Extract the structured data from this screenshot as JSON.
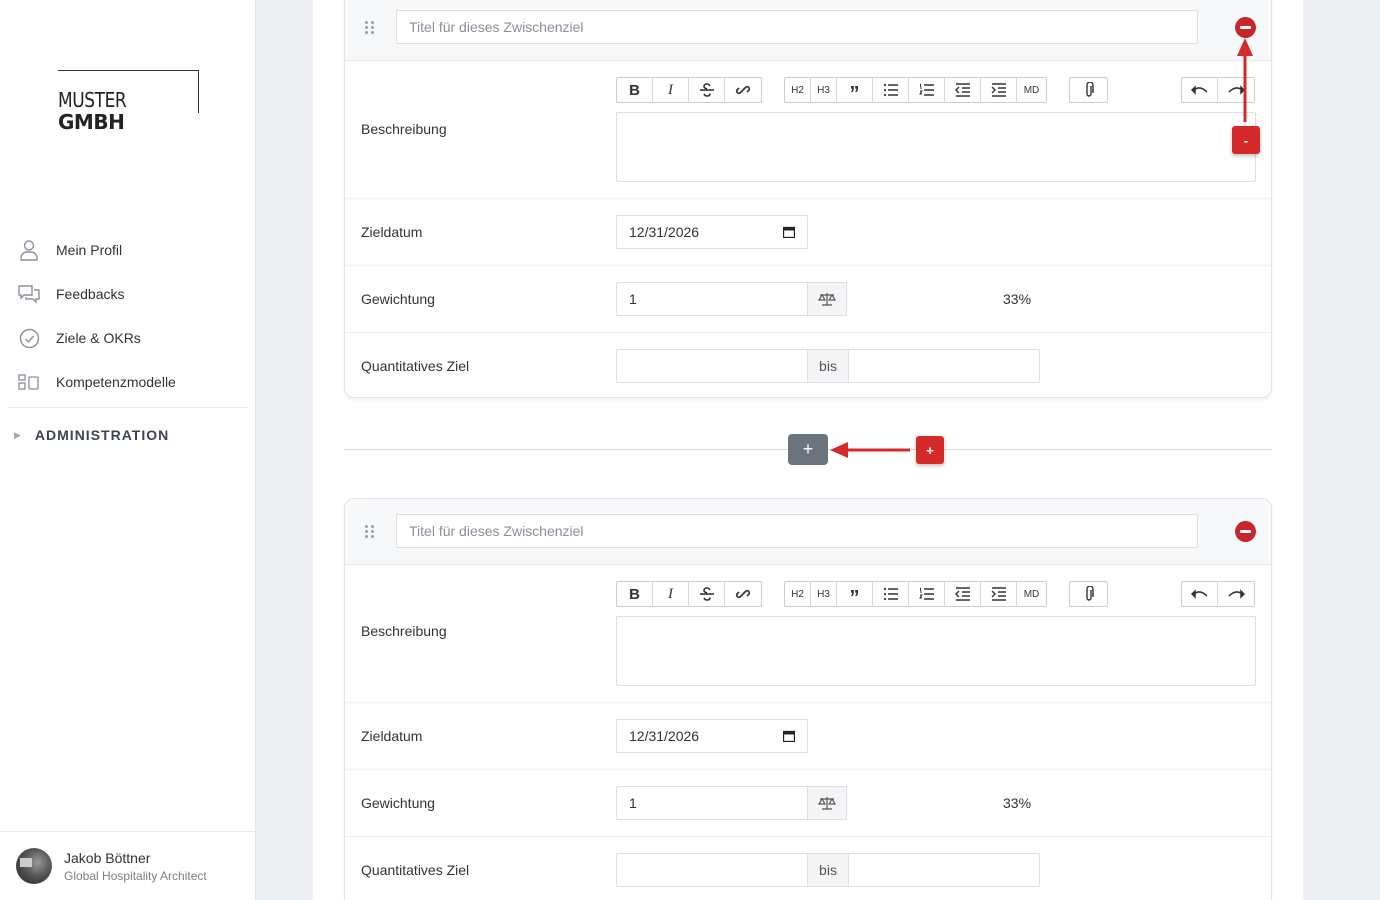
{
  "sidebar": {
    "logo": {
      "light": "MUSTER",
      "bold": "GMBH"
    },
    "items": [
      {
        "label": "Mein Profil",
        "icon": "user-icon"
      },
      {
        "label": "Feedbacks",
        "icon": "chat-icon"
      },
      {
        "label": "Ziele & OKRs",
        "icon": "check-circle-icon"
      },
      {
        "label": "Kompetenzmodelle",
        "icon": "model-icon"
      }
    ],
    "admin_label": "ADMINISTRATION",
    "user": {
      "name": "Jakob Böttner",
      "role": "Global Hospitality Architect"
    }
  },
  "milestones": [
    {
      "title_placeholder": "Titel für dieses Zwischenziel",
      "desc_label": "Beschreibung",
      "date_label": "Zieldatum",
      "date_value": "12/31/2026",
      "weight_label": "Gewichtung",
      "weight_value": "1",
      "weight_percent": "33%",
      "quant_label": "Quantitatives Ziel",
      "quant_separator": "bis"
    },
    {
      "title_placeholder": "Titel für dieses Zwischenziel",
      "desc_label": "Beschreibung",
      "date_label": "Zieldatum",
      "date_value": "12/31/2026",
      "weight_label": "Gewichtung",
      "weight_value": "1",
      "weight_percent": "33%",
      "quant_label": "Quantitatives Ziel",
      "quant_separator": "bis"
    }
  ],
  "toolbar": {
    "bold": "B",
    "italic": "I",
    "h2": "H2",
    "h3": "H3",
    "markdown": "MD"
  },
  "add_button": "+",
  "annotations": {
    "remove_marker": "-",
    "add_marker": "+",
    "color": "#d42a2a"
  },
  "colors": {
    "accent_red": "#c9252d",
    "add_button": "#6c757d"
  }
}
